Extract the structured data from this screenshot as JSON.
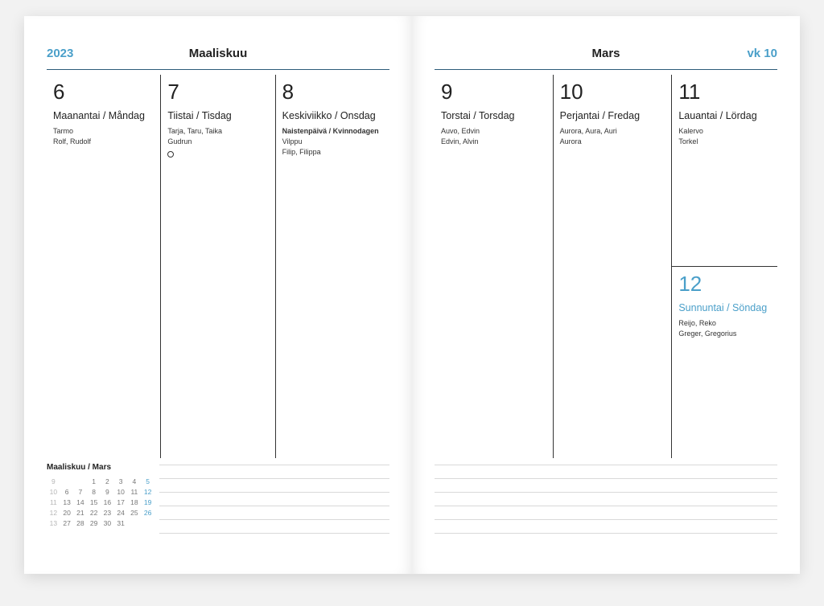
{
  "header": {
    "year": "2023",
    "month_left": "Maaliskuu",
    "month_right": "Mars",
    "week": "vk 10"
  },
  "days": [
    {
      "date": "6",
      "dow": "Maanantai / Måndag",
      "lines": [
        "Tarmo",
        "Rolf, Rudolf"
      ],
      "moon": false
    },
    {
      "date": "7",
      "dow": "Tiistai / Tisdag",
      "lines": [
        "Tarja, Taru, Taika",
        "Gudrun"
      ],
      "moon": true
    },
    {
      "date": "8",
      "dow": "Keskiviikko / Onsdag",
      "lines_bold": [
        "Naistenpäivä / Kvinnodagen"
      ],
      "lines": [
        "Vilppu",
        "Filip, Filippa"
      ],
      "moon": false
    },
    {
      "date": "9",
      "dow": "Torstai / Torsdag",
      "lines": [
        "Auvo, Edvin",
        "Edvin, Alvin"
      ],
      "moon": false
    },
    {
      "date": "10",
      "dow": "Perjantai / Fredag",
      "lines": [
        "Aurora, Aura, Auri",
        "Aurora"
      ],
      "moon": false
    },
    {
      "date": "11",
      "dow": "Lauantai / Lördag",
      "lines": [
        "Kalervo",
        "Torkel"
      ],
      "moon": false
    },
    {
      "date": "12",
      "dow": "Sunnuntai / Söndag",
      "lines": [
        "Reijo, Reko",
        "Greger, Gregorius"
      ],
      "moon": false
    }
  ],
  "minical": {
    "title": "Maaliskuu / Mars",
    "rows": [
      [
        "9",
        "",
        "",
        "1",
        "2",
        "3",
        "4",
        "5"
      ],
      [
        "10",
        "6",
        "7",
        "8",
        "9",
        "10",
        "11",
        "12"
      ],
      [
        "11",
        "13",
        "14",
        "15",
        "16",
        "17",
        "18",
        "19"
      ],
      [
        "12",
        "20",
        "21",
        "22",
        "23",
        "24",
        "25",
        "26"
      ],
      [
        "13",
        "27",
        "28",
        "29",
        "30",
        "31",
        "",
        ""
      ]
    ]
  }
}
